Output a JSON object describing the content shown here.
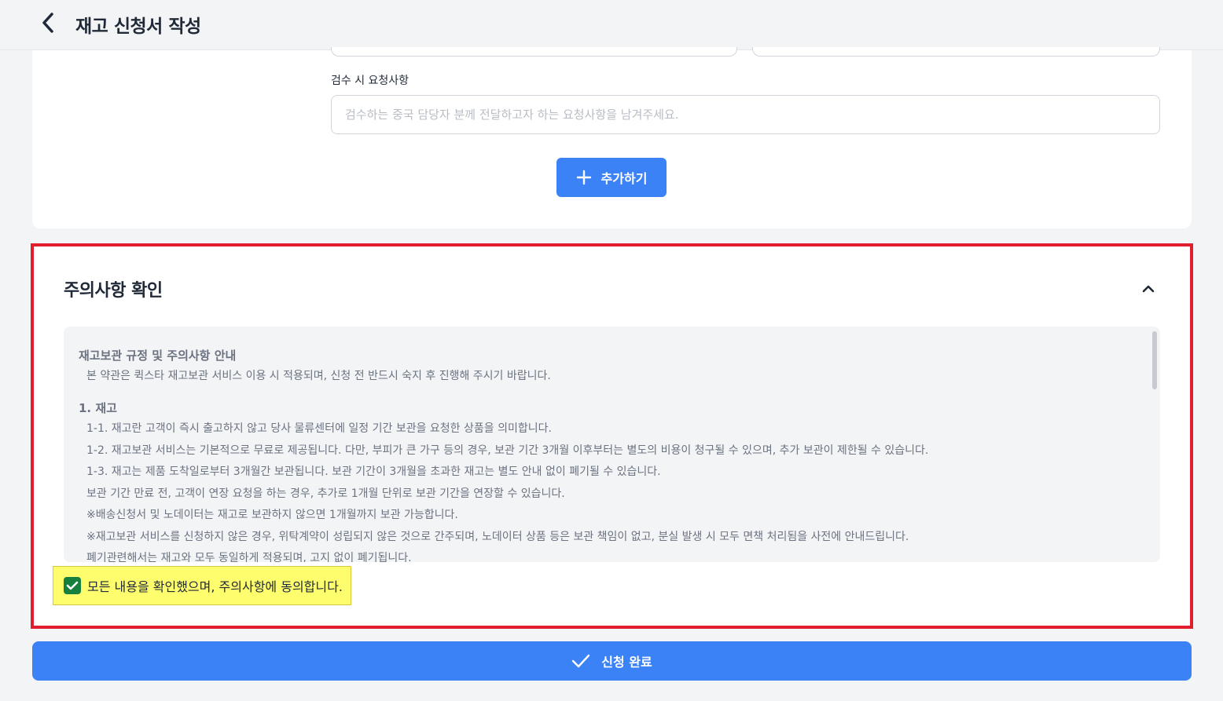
{
  "header": {
    "title": "재고 신청서 작성",
    "back_icon": "chevron-left-icon"
  },
  "form": {
    "request_label": "검수 시 요청사항",
    "request_value": "",
    "request_placeholder": "검수하는 중국 담당자 분께 전달하고자 하는 요청사항을 남겨주세요.",
    "add_button_label": "추가하기",
    "add_icon": "plus-icon"
  },
  "caution": {
    "title": "주의사항 확인",
    "toggle_icon": "chevron-up-icon",
    "terms": {
      "heading": "재고보관 규정 및 주의사항 안내",
      "intro": "본 약관은 퀵스타 재고보관 서비스 이용 시 적용되며, 신청 전 반드시 숙지 후 진행해 주시기 바랍니다.",
      "section_title": "1. 재고",
      "lines": [
        "1-1. 재고란 고객이 즉시 출고하지 않고 당사 물류센터에 일정 기간 보관을 요청한 상품을 의미합니다.",
        "1-2. 재고보관 서비스는 기본적으로 무료로 제공됩니다. 다만, 부피가 큰 가구 등의 경우, 보관 기간 3개월 이후부터는 별도의 비용이 청구될 수 있으며, 추가 보관이 제한될 수 있습니다.",
        "1-3. 재고는 제품 도착일로부터 3개월간 보관됩니다. 보관 기간이 3개월을 초과한 재고는 별도 안내 없이 폐기될 수 있습니다.",
        "보관 기간 만료 전, 고객이 연장 요청을 하는 경우, 추가로 1개월 단위로 보관 기간을 연장할 수 있습니다.",
        "※배송신청서 및 노데이터는 재고로 보관하지 않으면 1개월까지 보관 가능합니다.",
        "※재고보관 서비스를 신청하지 않은 경우, 위탁계약이 성립되지 않은 것으로 간주되며, 노데이터 상품 등은 보관 책임이 없고, 분실 발생 시 모두 면책 처리됨을 사전에 안내드립니다.",
        "폐기관련해서는 재고와 모두 동일하게 적용되며, 고지 없이 폐기됩니다."
      ]
    },
    "agree_label": "모든 내용을 확인했으며, 주의사항에 동의합니다.",
    "agree_checked": true,
    "check_icon": "check-icon"
  },
  "submit": {
    "label": "신청 완료",
    "icon": "check-icon"
  },
  "colors": {
    "primary": "#3b82f6",
    "highlight_border": "#e11d2e",
    "agree_highlight": "#fdfd6e",
    "checkbox": "#15803d"
  }
}
